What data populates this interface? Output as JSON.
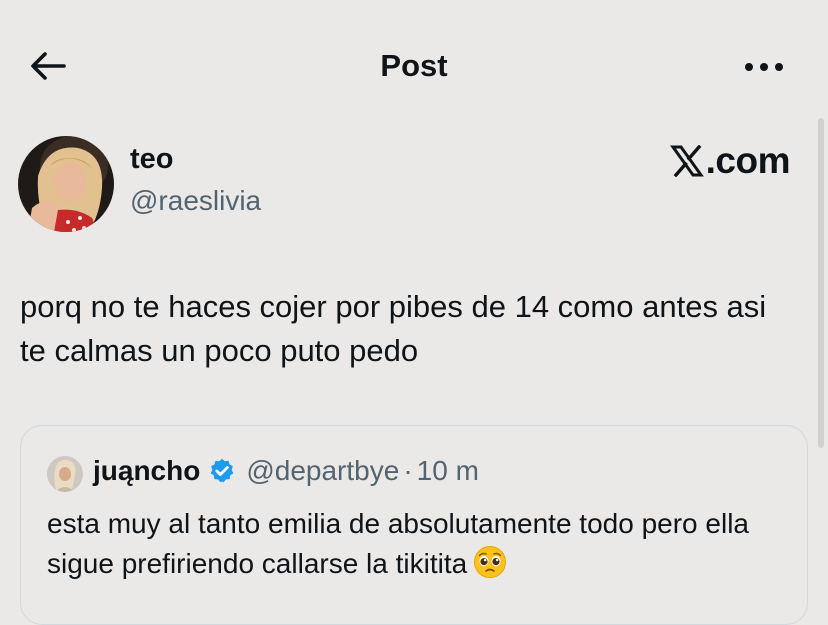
{
  "header": {
    "title": "Post",
    "back_icon": "arrow-left-icon",
    "more_icon": "more-horizontal-icon"
  },
  "post": {
    "author": {
      "display_name": "teo",
      "handle": "@raeslivia"
    },
    "watermark": ".com",
    "text": "porq no te haces cojer por pibes de 14 como antes asi te calmas un poco puto pedo"
  },
  "quoted_post": {
    "display_name": "juąncho",
    "handle": "@departbye",
    "separator": "·",
    "time": "10 m",
    "text": "esta muy al tanto emilia de absolutamente todo pero ella sigue prefiriendo callarse la tikitita",
    "emoji": "pleading-face"
  },
  "colors": {
    "background": "#ebe9e7",
    "text": "#0f1419",
    "secondary_text": "#536471",
    "verified": "#1d9bf0",
    "border": "#cfd9de"
  }
}
